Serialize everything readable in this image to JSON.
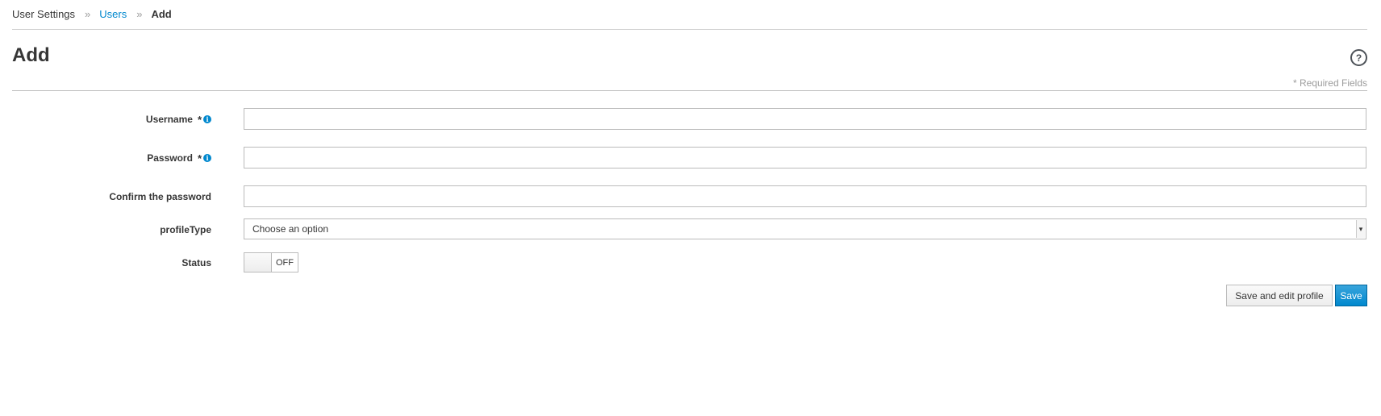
{
  "breadcrumb": {
    "items": [
      {
        "label": "User Settings"
      },
      {
        "label": "Users"
      },
      {
        "label": "Add"
      }
    ],
    "separator": "»"
  },
  "page": {
    "title": "Add",
    "help_icon": "question-circle-icon",
    "required_note": "* Required Fields"
  },
  "form": {
    "username": {
      "label": "Username",
      "required_mark": "*",
      "info_icon": "info-circle-icon",
      "value": ""
    },
    "password": {
      "label": "Password",
      "required_mark": "*",
      "info_icon": "info-circle-icon",
      "value": ""
    },
    "confirm_password": {
      "label": "Confirm the password",
      "value": ""
    },
    "profile_type": {
      "label": "profileType",
      "selected": "Choose an option"
    },
    "status": {
      "label": "Status",
      "state": "OFF"
    }
  },
  "actions": {
    "save_and_edit_label": "Save and edit profile",
    "save_label": "Save"
  },
  "colors": {
    "link": "#0088ce",
    "primary_button": "#0088ce",
    "text": "#363636",
    "muted": "#9c9c9c"
  }
}
